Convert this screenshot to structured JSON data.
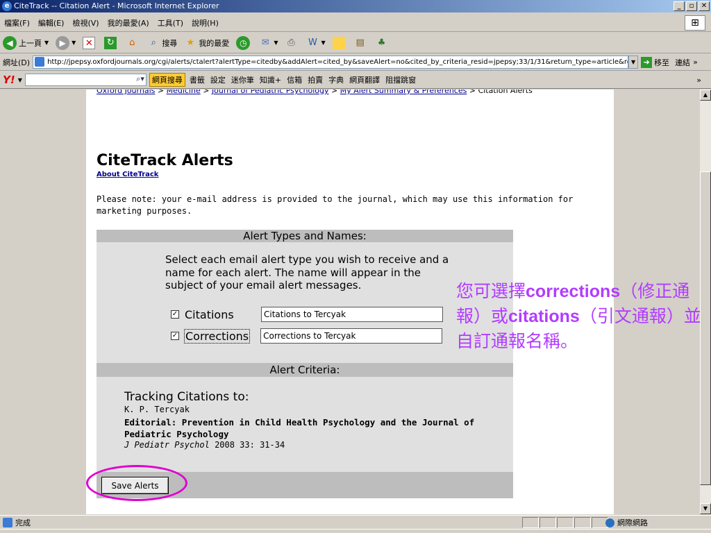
{
  "window": {
    "title": "CiteTrack -- Citation Alert - Microsoft Internet Explorer"
  },
  "menu": [
    "檔案(F)",
    "編輯(E)",
    "檢視(V)",
    "我的最愛(A)",
    "工具(T)",
    "說明(H)"
  ],
  "toolbar": {
    "back": "上一頁",
    "search": "搜尋",
    "favorites": "我的最愛"
  },
  "address": {
    "label": "網址(D)",
    "url": "http://jpepsy.oxfordjournals.org/cgi/alerts/ctalert?alertType=citedby&addAlert=cited_by&saveAlert=no&cited_by_criteria_resid=jpepsy;33/1/31&return_type=article&return_url",
    "go": "移至",
    "links": "連結"
  },
  "yahoo": {
    "logo": "Y!",
    "search_button": "網頁搜尋",
    "items": [
      "書籤",
      "設定",
      "迷你筆",
      "知識+",
      "信箱",
      "拍賣",
      "字典",
      "網頁翻譯",
      "阻擋跳窗"
    ]
  },
  "page": {
    "breadcrumb": [
      "Oxford Journals",
      "Medicine",
      "Journal of Pediatric Psychology",
      "My Alert Summary & Preferences",
      "Citation Alerts"
    ],
    "title": "CiteTrack Alerts",
    "about_link": "About CiteTrack",
    "notice": "Please note: your e-mail address is provided to the journal, which may use this information for marketing purposes.",
    "alert_types_header": "Alert Types and Names:",
    "instructions": "Select each email alert type you wish to receive and a name for each alert. The name will appear in the subject of your email alert messages.",
    "options": [
      {
        "label": "Citations",
        "value": "Citations to Tercyak",
        "checked": true
      },
      {
        "label": "Corrections",
        "value": "Corrections to Tercyak",
        "checked": true
      }
    ],
    "criteria_header": "Alert Criteria:",
    "tracking_label": "Tracking Citations to:",
    "authors": "K. P. Tercyak",
    "article_title": "Editorial: Prevention in Child Health Psychology and the Journal of Pediatric Psychology",
    "journal": "J Pediatr Psychol",
    "citation_details": "2008 33: 31-34",
    "save_button": "Save Alerts"
  },
  "annotation": {
    "part1": "您可選擇",
    "bold1": "corrections",
    "part2": "（修正通報）或",
    "bold2": "citations",
    "part3": "（引文通報）並自訂通報名稱。"
  },
  "status": {
    "text": "完成",
    "zone": "網際網路"
  },
  "colors": {
    "annotation": "#b23cff",
    "highlight_circle": "#e000d0",
    "link": "#00008b"
  }
}
